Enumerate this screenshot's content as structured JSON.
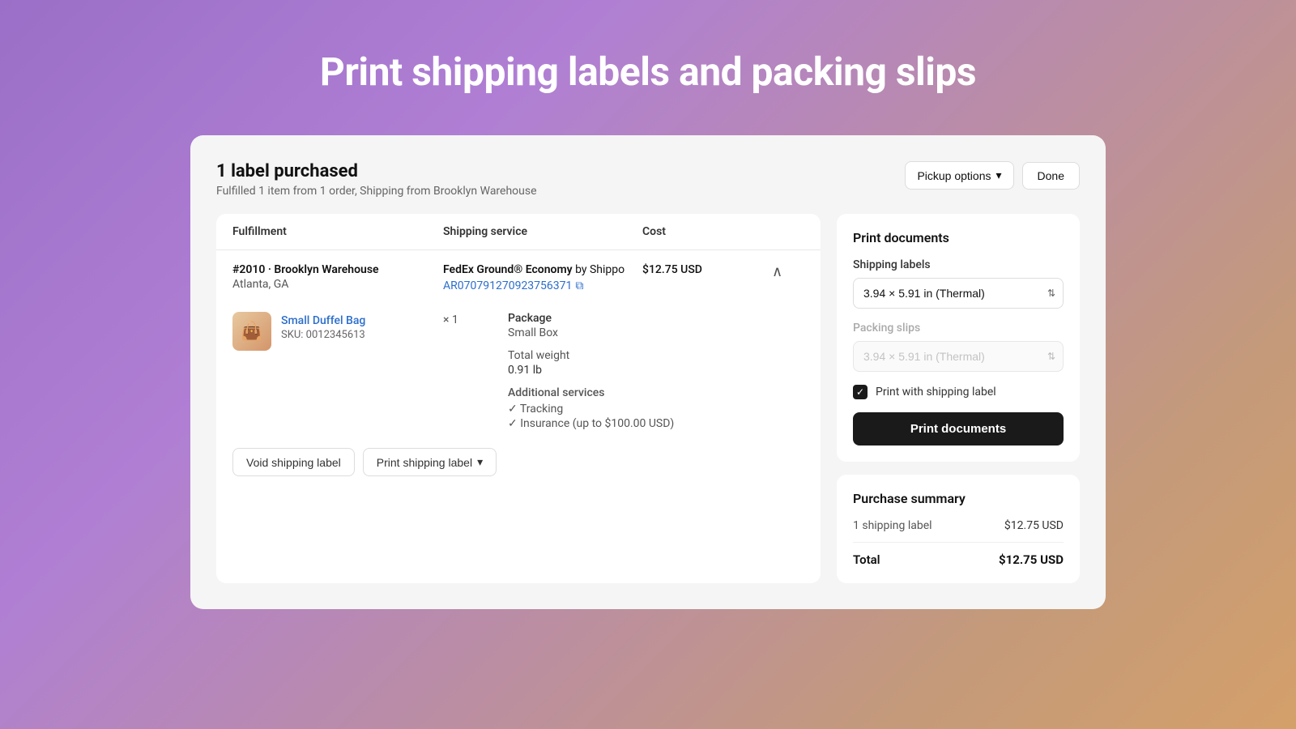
{
  "hero": {
    "title": "Print shipping labels and packing slips"
  },
  "card": {
    "header": {
      "title": "1 label purchased",
      "subtitle": "Fulfilled 1 item from 1 order, Shipping from Brooklyn Warehouse"
    },
    "pickup_button": "Pickup options",
    "done_button": "Done"
  },
  "table": {
    "columns": {
      "fulfillment": "Fulfillment",
      "shipping_service": "Shipping service",
      "cost": "Cost"
    },
    "row": {
      "order_id": "#2010 · Brooklyn Warehouse",
      "location": "Atlanta, GA",
      "service_name": "FedEx Ground® Economy",
      "service_by": "by Shippo",
      "tracking_number": "AR070791270923756371",
      "cost": "$12.75 USD",
      "item_name": "Small Duffel Bag",
      "item_sku": "SKU: 0012345613",
      "quantity": "× 1",
      "package_label": "Package",
      "package_value": "Small Box",
      "weight_label": "Total weight",
      "weight_value": "0.91 lb",
      "additional_services_label": "Additional services",
      "services": [
        "✓ Tracking",
        "✓ Insurance (up to $100.00 USD)"
      ],
      "void_label": "Void shipping label",
      "print_label": "Print shipping label"
    }
  },
  "print_docs": {
    "title": "Print documents",
    "shipping_labels_label": "Shipping labels",
    "shipping_labels_value": "3.94 × 5.91 in (Thermal)",
    "packing_slips_label": "Packing slips",
    "packing_slips_value": "3.94 × 5.91 in (Thermal)",
    "checkbox_label": "Print with shipping label",
    "print_button": "Print documents"
  },
  "purchase_summary": {
    "title": "Purchase summary",
    "items": [
      {
        "label": "1 shipping label",
        "value": "$12.75 USD"
      }
    ],
    "total_label": "Total",
    "total_value": "$12.75 USD"
  }
}
